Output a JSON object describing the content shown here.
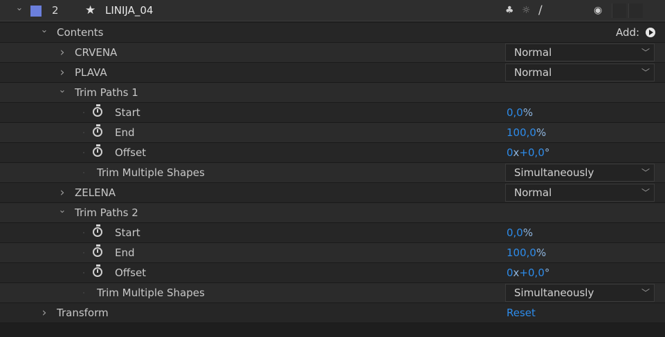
{
  "layer": {
    "number": "2",
    "name": "LINIJA_04",
    "label_color": "#6b7fdc",
    "star_icon": "star-icon",
    "switch_icons": [
      "shy-icon",
      "collapse-icon",
      "quality-icon",
      "motion-blur-icon"
    ]
  },
  "contents": {
    "label": "Contents",
    "add_label": "Add:"
  },
  "rows": {
    "crvena": {
      "label": "CRVENA",
      "mode": "Normal"
    },
    "plava": {
      "label": "PLAVA",
      "mode": "Normal"
    },
    "trim1": {
      "label": "Trim Paths 1",
      "start_label": "Start",
      "start_value": "0,0",
      "start_unit": "%",
      "end_label": "End",
      "end_value": "100,0",
      "end_unit": "%",
      "offset_label": "Offset",
      "offset_rev": "0",
      "offset_x": "x",
      "offset_value": "+0,0",
      "offset_unit": "°",
      "multi_label": "Trim Multiple Shapes",
      "multi_value": "Simultaneously"
    },
    "zelena": {
      "label": "ZELENA",
      "mode": "Normal"
    },
    "trim2": {
      "label": "Trim Paths 2",
      "start_label": "Start",
      "start_value": "0,0",
      "start_unit": "%",
      "end_label": "End",
      "end_value": "100,0",
      "end_unit": "%",
      "offset_label": "Offset",
      "offset_rev": "0",
      "offset_x": "x",
      "offset_value": "+0,0",
      "offset_unit": "°",
      "multi_label": "Trim Multiple Shapes",
      "multi_value": "Simultaneously"
    },
    "transform": {
      "label": "Transform",
      "reset": "Reset"
    }
  },
  "colors": {
    "value_blue": "#2d8ceb",
    "background": "#1e1e1e"
  }
}
